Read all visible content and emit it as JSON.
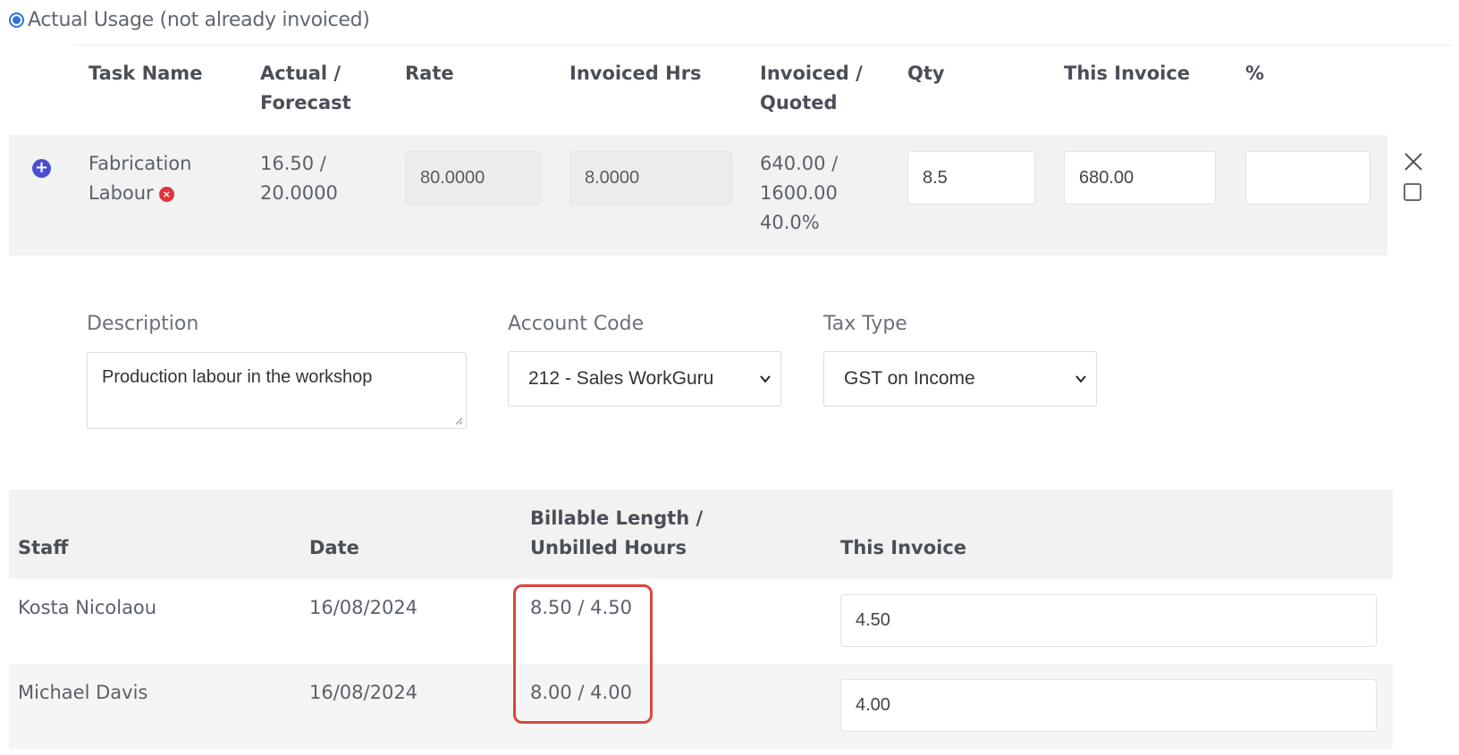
{
  "usage_option": {
    "label": "Actual Usage (not already invoiced)",
    "selected": true
  },
  "task_table": {
    "headers": {
      "task_name": "Task Name",
      "actual_forecast_1": "Actual /",
      "actual_forecast_2": "Forecast",
      "rate": "Rate",
      "invoiced_hrs": "Invoiced Hrs",
      "invoiced_quoted_1": "Invoiced /",
      "invoiced_quoted_2": "Quoted",
      "qty": "Qty",
      "this_invoice": "This Invoice",
      "percent": "%"
    },
    "row": {
      "task_name_1": "Fabrication",
      "task_name_2": "Labour",
      "actual_forecast_1": "16.50 /",
      "actual_forecast_2": "20.0000",
      "rate": "80.0000",
      "invoiced_hrs": "8.0000",
      "invoiced_quoted_1": "640.00 /",
      "invoiced_quoted_2": "1600.00",
      "invoiced_quoted_3": "40.0%",
      "qty": "8.5",
      "this_invoice": "680.00",
      "percent": ""
    }
  },
  "form": {
    "description_label": "Description",
    "description_value": "Production labour in the workshop",
    "account_code_label": "Account Code",
    "account_code_value": "212 - Sales WorkGuru",
    "tax_type_label": "Tax Type",
    "tax_type_value": "GST on Income"
  },
  "staff_table": {
    "headers": {
      "staff": "Staff",
      "date": "Date",
      "billable_1": "Billable Length /",
      "billable_2": "Unbilled Hours",
      "this_invoice": "This Invoice"
    },
    "rows": [
      {
        "staff": "Kosta Nicolaou",
        "date": "16/08/2024",
        "billable": "8.50 / 4.50",
        "this_invoice": "4.50"
      },
      {
        "staff": "Michael Davis",
        "date": "16/08/2024",
        "billable": "8.00 / 4.00",
        "this_invoice": "4.00"
      }
    ]
  },
  "colors": {
    "accent": "#2f74d9",
    "highlight": "#d8473f",
    "error": "#e0333b",
    "add_button": "#4a4fd0"
  }
}
